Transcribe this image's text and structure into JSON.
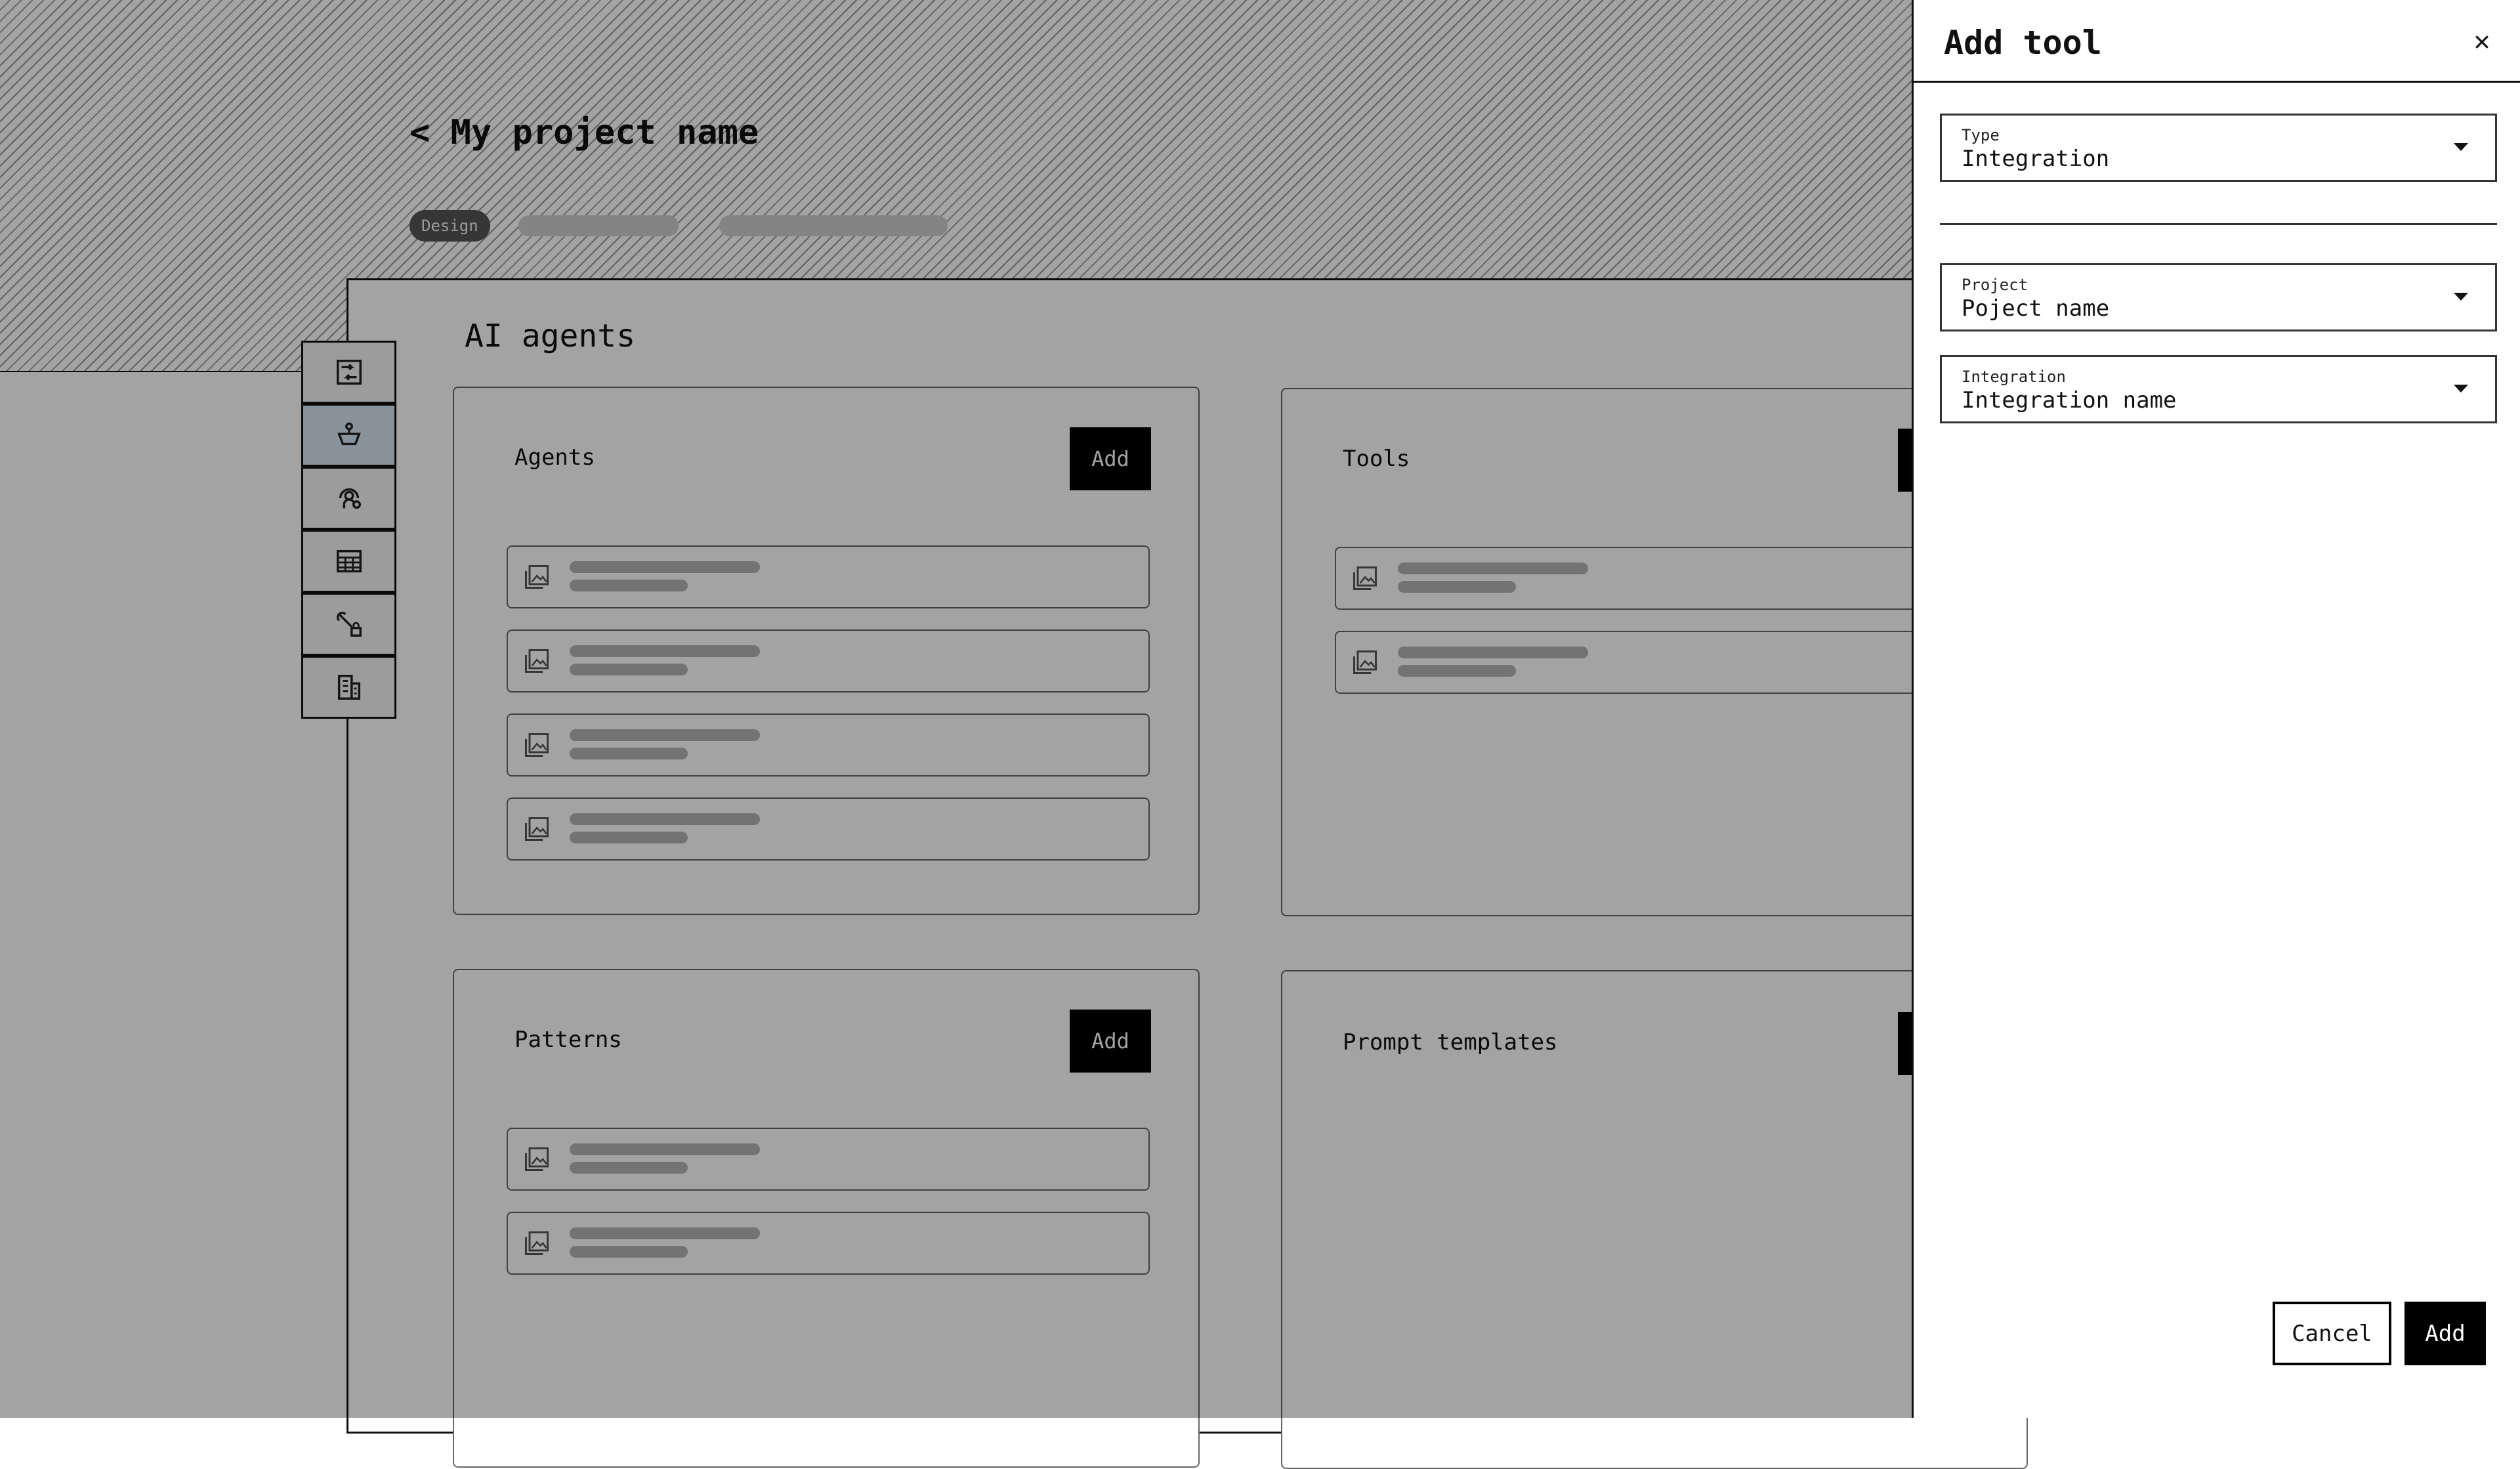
{
  "page": {
    "back_title": "< My project name",
    "tag_design": "Design",
    "heading": "AI agents"
  },
  "rail": {
    "items": [
      {
        "icon": "workflow-icon",
        "active": false
      },
      {
        "icon": "agent-icon",
        "active": true
      },
      {
        "icon": "support-agent-icon",
        "active": false
      },
      {
        "icon": "table-icon",
        "active": false
      },
      {
        "icon": "tools-icon",
        "active": false
      },
      {
        "icon": "building-icon",
        "active": false
      }
    ]
  },
  "cards": {
    "agents": {
      "title": "Agents",
      "add_label": "Add",
      "item_count": 4
    },
    "tools": {
      "title": "Tools",
      "add_label": "Add",
      "item_count": 2
    },
    "patterns": {
      "title": "Patterns",
      "add_label": "Add",
      "item_count": 2
    },
    "prompt_templates": {
      "title": "Prompt templates",
      "add_label": "Add",
      "item_count": 0
    }
  },
  "drawer": {
    "title": "Add tool",
    "close_icon": "close-icon",
    "fields": {
      "type": {
        "label": "Type",
        "value": "Integration"
      },
      "project": {
        "label": "Project",
        "value": "Poject name"
      },
      "integration": {
        "label": "Integration",
        "value": "Integration name"
      }
    },
    "cancel_label": "Cancel",
    "add_label": "Add"
  }
}
